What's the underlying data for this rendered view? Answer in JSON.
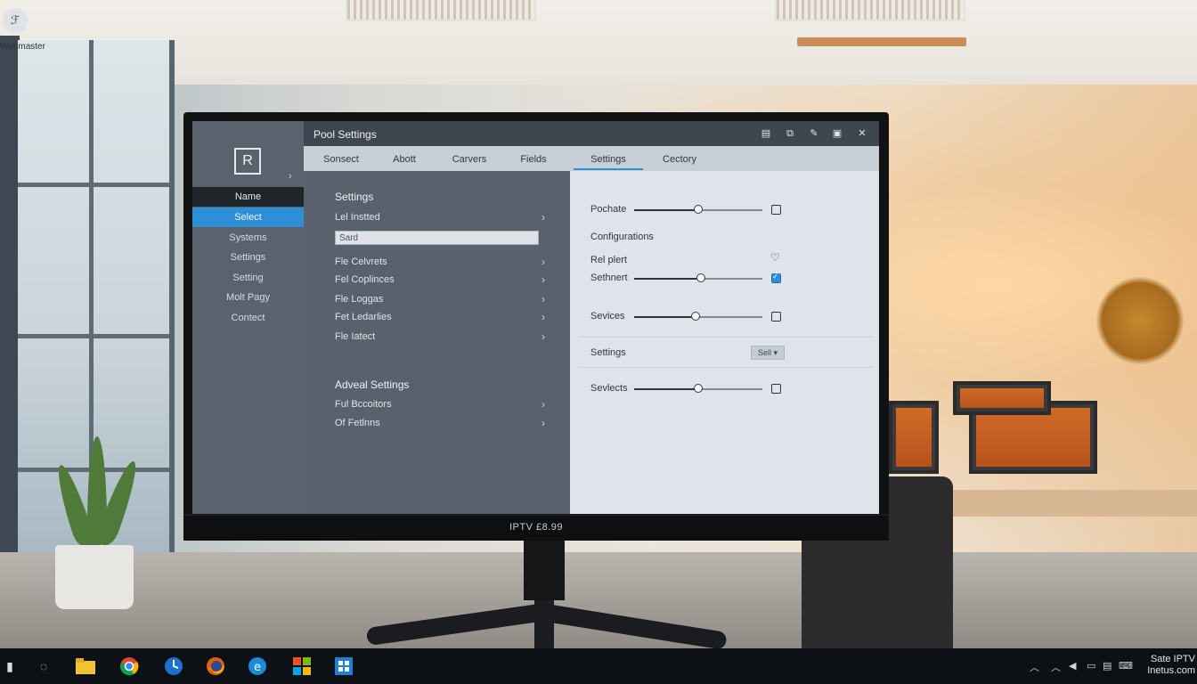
{
  "desktop": {
    "corner_icon_glyph": "ℱ",
    "corner_label": "Webmaster"
  },
  "window": {
    "title": "Pool Settings",
    "logo_letter": "R",
    "chin_label": "IPTV £8.99"
  },
  "leftnav": {
    "items": [
      {
        "label": "Name"
      },
      {
        "label": "Select"
      },
      {
        "label": "Systems"
      },
      {
        "label": "Settings"
      },
      {
        "label": "Setting"
      },
      {
        "label": "Molt Pagy"
      },
      {
        "label": "Contect"
      }
    ]
  },
  "tabs": [
    {
      "label": "Sonsect"
    },
    {
      "label": "Abott"
    },
    {
      "label": "Carvers"
    },
    {
      "label": "Fields"
    },
    {
      "label": "Settings"
    },
    {
      "label": "Cectory"
    }
  ],
  "middle": {
    "section1_title": "Settings",
    "row_first": "Lel Instted",
    "input_value": "Sard",
    "rows": [
      {
        "label": "Fle Celvrets"
      },
      {
        "label": "Fel Coplinces"
      },
      {
        "label": "Fle Loggas"
      },
      {
        "label": "Fet Ledarlies"
      },
      {
        "label": "Fle Iatect"
      }
    ],
    "section2_title": "Adveal Settings",
    "rows2": [
      {
        "label": "Ful Bccoitors"
      },
      {
        "label": "Of Fetlnns"
      }
    ]
  },
  "right": {
    "row1_label": "Pochate",
    "configurations_title": "Configurations",
    "row_rel_label": "Rel plert",
    "row2_label": "Sethnert",
    "row3_label": "Sevices",
    "settings_label": "Settings",
    "dropdown_value": "Sell",
    "row4_label": "Sevlects",
    "sliders": [
      0.5,
      0.52,
      0.48,
      0.5
    ],
    "checkboxes": [
      false,
      true,
      false,
      false
    ],
    "heart_glyph": "♡"
  },
  "taskbar": {
    "tray_text_line1": "Sate IPTV",
    "tray_text_line2": "Inetus.com"
  },
  "colors": {
    "accent": "#2f8fd6",
    "nav_bg": "#59626d",
    "right_panel_bg": "#dfe4ea"
  }
}
